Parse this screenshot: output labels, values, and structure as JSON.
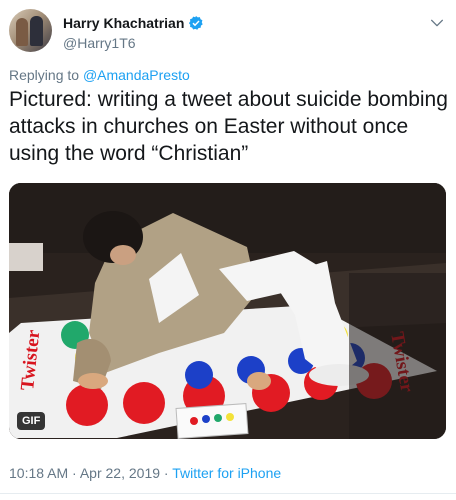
{
  "author": {
    "display_name": "Harry Khachatrian",
    "handle": "@Harry1T6",
    "verified_icon": "verified-badge-icon"
  },
  "reply": {
    "prefix": "Replying to",
    "mention": "@AmandaPresto"
  },
  "tweet": {
    "text": "Pictured: writing a tweet about suicide bombing attacks in churches on Easter without once using the word “Christian”"
  },
  "media": {
    "badge": "GIF",
    "mat_text": "Twister"
  },
  "meta": {
    "time": "10:18 AM",
    "date": "Apr 22, 2019",
    "separator": "·",
    "source": "Twitter for iPhone"
  },
  "colors": {
    "accent": "#1da1f2",
    "secondary_text": "#657786",
    "primary_text": "#14171a"
  }
}
